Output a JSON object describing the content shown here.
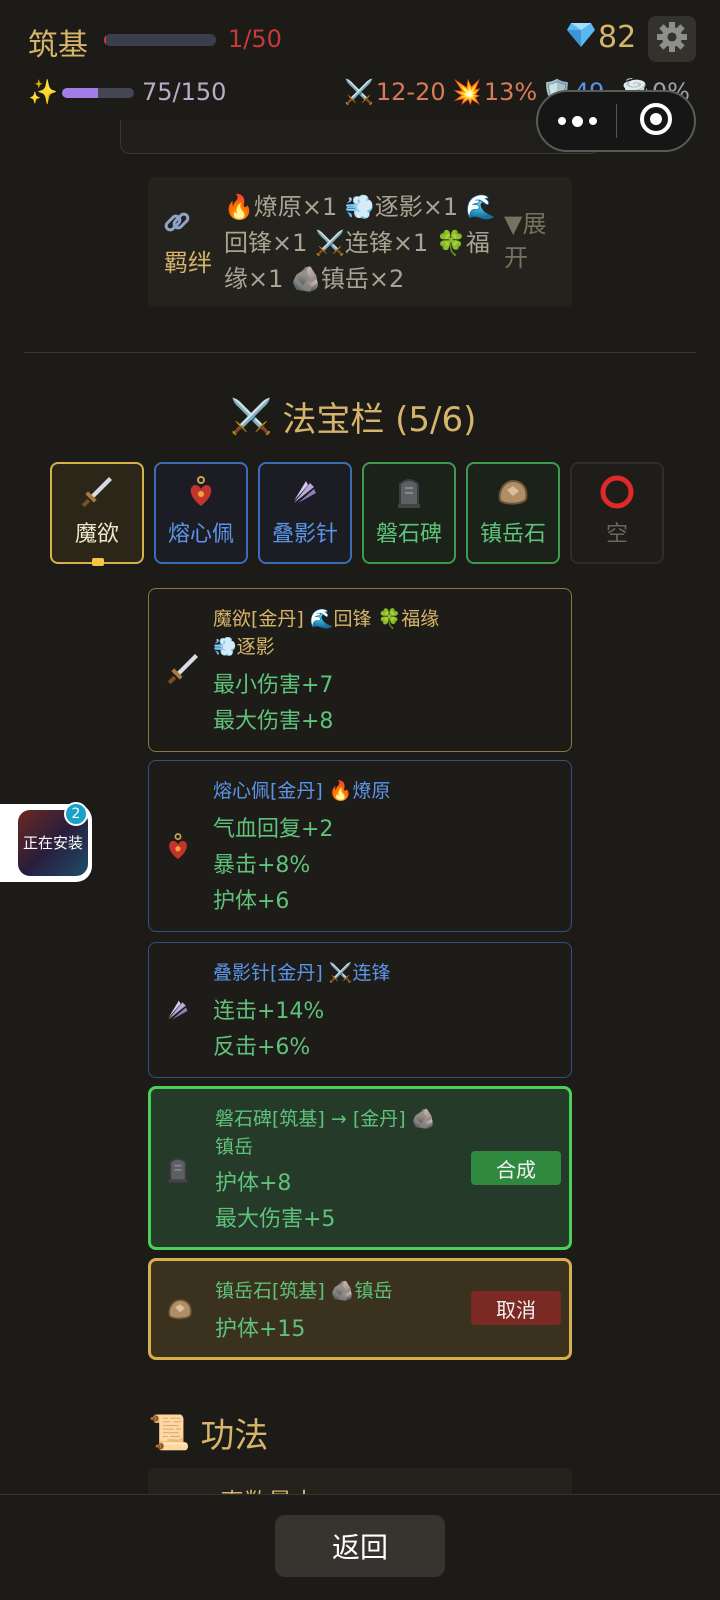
{
  "header": {
    "realm": "筑基",
    "hp_text": "1/50",
    "hp_fraction": 0.02,
    "gem_count": "82",
    "exp_text": "75/150",
    "exp_fraction": 0.5,
    "attack": "12-20",
    "crit": "13%",
    "armor": "49",
    "dodge": "0%"
  },
  "bond": {
    "label": "羁绊",
    "items": [
      "🔥燎原×1",
      "💨逐影×1",
      "🌊回锋×1",
      "⚔️连锋×1",
      "🍀福缘×1",
      "🪨镇岳×2"
    ],
    "expand": "▼展开"
  },
  "artifacts": {
    "title": "法宝栏 (5/6)",
    "slots": [
      {
        "name": "魔欲",
        "icon": "dagger-icon"
      },
      {
        "name": "熔心佩",
        "icon": "heart-pendant-icon"
      },
      {
        "name": "叠影针",
        "icon": "feather-needle-icon"
      },
      {
        "name": "磐石碑",
        "icon": "stone-tablet-icon"
      },
      {
        "name": "镇岳石",
        "icon": "rock-icon"
      },
      {
        "name": "空",
        "icon": "empty-circle-icon"
      }
    ]
  },
  "cards": [
    {
      "title": "魔欲[金丹] 🌊回锋 🍀福缘",
      "title2": "💨逐影",
      "lines": [
        "最小伤害+7",
        "最大伤害+8"
      ]
    },
    {
      "title": "熔心佩[金丹] 🔥燎原",
      "lines": [
        "气血回复+2",
        "暴击+8%",
        "护体+6"
      ]
    },
    {
      "title": "叠影针[金丹] ⚔️连锋",
      "lines": [
        "连击+14%",
        "反击+6%"
      ]
    },
    {
      "title": "磐石碑[筑基] → [金丹] 🪨",
      "title2": "镇岳",
      "lines": [
        "护体+8",
        "最大伤害+5"
      ],
      "button": "合成"
    },
    {
      "title": "镇岳石[筑基] 🪨镇岳",
      "lines": [
        "护体+15"
      ],
      "button": "取消"
    }
  ],
  "gongfa": {
    "title": "功法",
    "partial_item": "真数最大"
  },
  "install_widget": {
    "text": "正在安装",
    "badge": "2"
  },
  "bottom": {
    "back_label": "返回"
  },
  "colors": {
    "gold": "#d6b46a",
    "blue_quality": "#5b95e8",
    "green_quality": "#5ec27a",
    "red": "#c8393a"
  }
}
